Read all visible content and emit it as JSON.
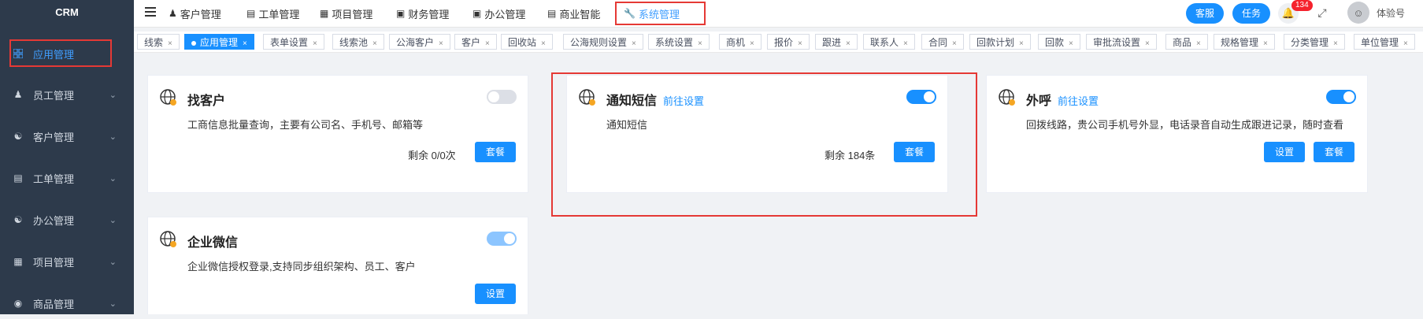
{
  "app": {
    "brand": "CRM"
  },
  "sidebar": {
    "items": [
      {
        "label": "应用管理",
        "icon": "apps-icon"
      },
      {
        "label": "员工管理",
        "icon": "user-icon"
      },
      {
        "label": "客户管理",
        "icon": "customers-icon"
      },
      {
        "label": "工单管理",
        "icon": "ticket-icon"
      },
      {
        "label": "办公管理",
        "icon": "office-icon"
      },
      {
        "label": "项目管理",
        "icon": "project-icon"
      },
      {
        "label": "商品管理",
        "icon": "goods-icon"
      }
    ]
  },
  "topnav": {
    "items": [
      {
        "label": "客户管理"
      },
      {
        "label": "工单管理"
      },
      {
        "label": "项目管理"
      },
      {
        "label": "财务管理"
      },
      {
        "label": "办公管理"
      },
      {
        "label": "商业智能"
      },
      {
        "label": "系统管理"
      }
    ],
    "service_label": "客服",
    "task_label": "任务",
    "notification_count": "134",
    "user_name": "体验号"
  },
  "tabs": [
    {
      "label": "线索"
    },
    {
      "label": "应用管理"
    },
    {
      "label": "表单设置"
    },
    {
      "label": "线索池"
    },
    {
      "label": "公海客户"
    },
    {
      "label": "客户"
    },
    {
      "label": "回收站"
    },
    {
      "label": "公海规则设置"
    },
    {
      "label": "系统设置"
    },
    {
      "label": "商机"
    },
    {
      "label": "报价"
    },
    {
      "label": "跟进"
    },
    {
      "label": "联系人"
    },
    {
      "label": "合同"
    },
    {
      "label": "回款计划"
    },
    {
      "label": "回款"
    },
    {
      "label": "审批流设置"
    },
    {
      "label": "商品"
    },
    {
      "label": "规格管理"
    },
    {
      "label": "分类管理"
    },
    {
      "label": "单位管理"
    }
  ],
  "cards": {
    "find_customer": {
      "title": "找客户",
      "desc": "工商信息批量查询，主要有公司名、手机号、邮箱等",
      "remaining": "剩余 0/0次",
      "package_label": "套餐"
    },
    "sms": {
      "title": "通知短信",
      "link": "前往设置",
      "desc": "通知短信",
      "remaining": "剩余 184条",
      "package_label": "套餐"
    },
    "call": {
      "title": "外呼",
      "link": "前往设置",
      "desc": "回拨线路，贵公司手机号外显，电话录音自动生成跟进记录，随时查看",
      "settings_label": "设置",
      "package_label": "套餐"
    },
    "wecom": {
      "title": "企业微信",
      "desc": "企业微信授权登录,支持同步组织架构、员工、客户",
      "settings_label": "设置"
    }
  },
  "colors": {
    "primary": "#1890ff",
    "sidebar_bg": "#2d3a4b",
    "highlight": "#e53935",
    "badge": "#f5222d"
  }
}
